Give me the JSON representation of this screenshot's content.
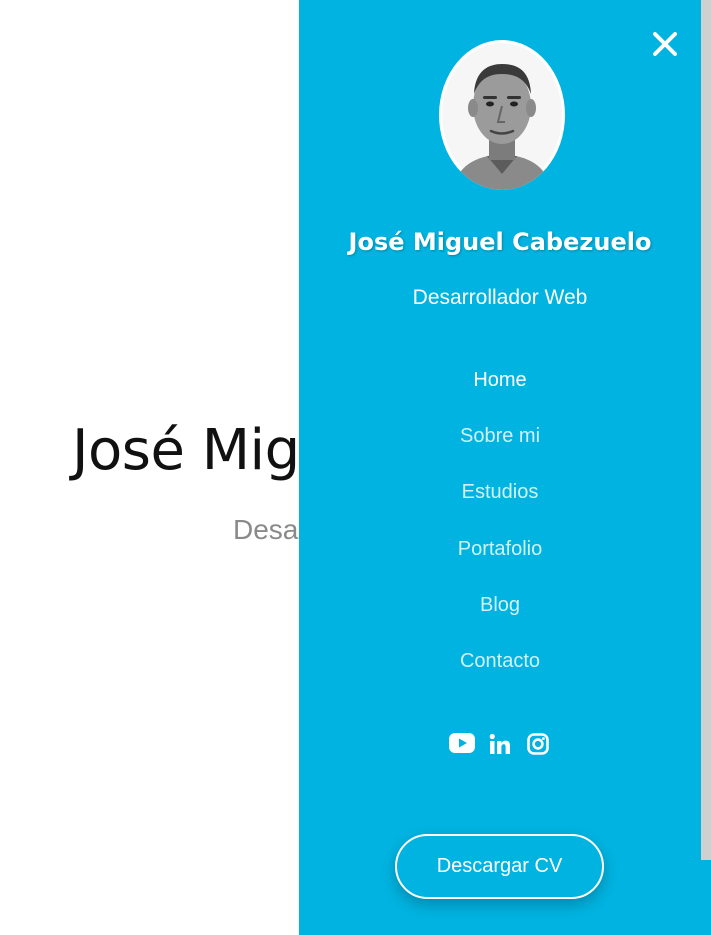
{
  "hero": {
    "title": "José Miguel Cabezuelo",
    "subtitle": "Desarrollador Web"
  },
  "panel": {
    "background_color": "#00b3e0",
    "name": "José Miguel Cabezuelo",
    "role": "Desarrollador Web",
    "close_icon": "close-x-icon",
    "nav": [
      {
        "label": "Home",
        "active": true
      },
      {
        "label": "Sobre mi",
        "active": false
      },
      {
        "label": "Estudios",
        "active": false
      },
      {
        "label": "Portafolio",
        "active": false
      },
      {
        "label": "Blog",
        "active": false
      },
      {
        "label": "Contacto",
        "active": false
      }
    ],
    "social": [
      {
        "icon": "youtube-icon"
      },
      {
        "icon": "linkedin-icon"
      },
      {
        "icon": "instagram-icon"
      }
    ],
    "cv_button": "Descargar CV"
  }
}
